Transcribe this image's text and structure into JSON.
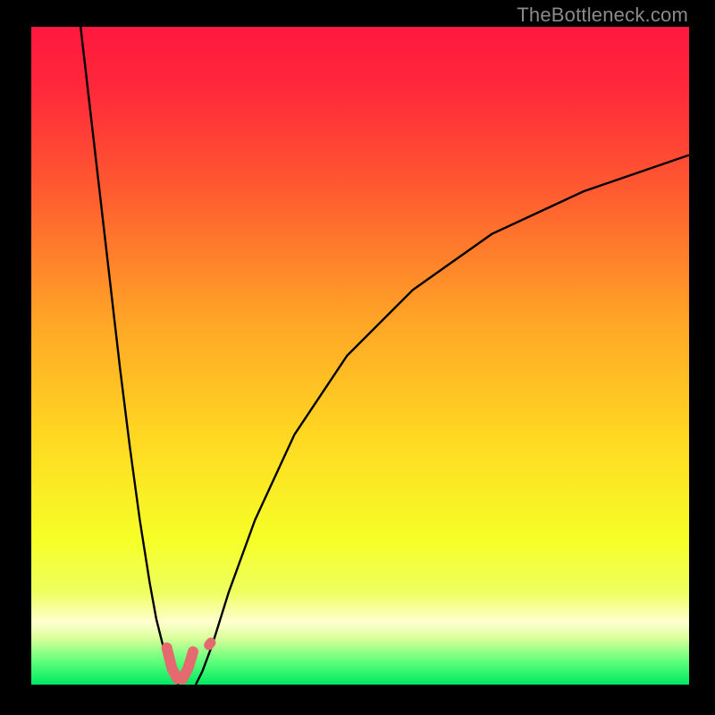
{
  "watermark": "TheBottleneck.com",
  "chart_data": {
    "type": "line",
    "title": "",
    "xlabel": "",
    "ylabel": "",
    "xlim": [
      0,
      100
    ],
    "ylim": [
      0,
      100
    ],
    "gradient_stops": [
      {
        "offset": 0.0,
        "color": "#ff183f"
      },
      {
        "offset": 0.1,
        "color": "#ff2a3a"
      },
      {
        "offset": 0.25,
        "color": "#ff5b30"
      },
      {
        "offset": 0.45,
        "color": "#ffa626"
      },
      {
        "offset": 0.62,
        "color": "#ffd722"
      },
      {
        "offset": 0.78,
        "color": "#f6ff27"
      },
      {
        "offset": 0.86,
        "color": "#eeff60"
      },
      {
        "offset": 0.905,
        "color": "#ffffd0"
      },
      {
        "offset": 0.93,
        "color": "#d8ff99"
      },
      {
        "offset": 0.965,
        "color": "#5fff7a"
      },
      {
        "offset": 1.0,
        "color": "#00e862"
      }
    ],
    "series": [
      {
        "name": "left-branch",
        "stroke": "#000000",
        "width": 2.4,
        "x": [
          7.5,
          9,
          10.5,
          12,
          13.5,
          15,
          16.5,
          18,
          19,
          20,
          20.8,
          21.5,
          22,
          22.4
        ],
        "y": [
          100,
          87,
          74,
          61,
          48,
          36,
          25,
          15.5,
          10,
          6,
          3.2,
          1.4,
          0.5,
          0
        ]
      },
      {
        "name": "right-branch",
        "stroke": "#000000",
        "width": 2.4,
        "x": [
          25,
          26,
          27.5,
          30,
          34,
          40,
          48,
          58,
          70,
          84,
          100
        ],
        "y": [
          0,
          2,
          6,
          14,
          25,
          38,
          50,
          60,
          68.5,
          75,
          80.5
        ]
      },
      {
        "name": "highlight-u",
        "stroke": "#e46a6f",
        "width": 12,
        "linecap": "round",
        "x": [
          20.6,
          21.4,
          22.2,
          23.0,
          23.8,
          24.6
        ],
        "y": [
          5.6,
          2.4,
          0.9,
          0.9,
          2.4,
          5.0
        ]
      },
      {
        "name": "highlight-dot",
        "stroke": "#e46a6f",
        "width": 11,
        "linecap": "round",
        "x": [
          27.0,
          27.3
        ],
        "y": [
          6.0,
          6.4
        ]
      }
    ]
  }
}
